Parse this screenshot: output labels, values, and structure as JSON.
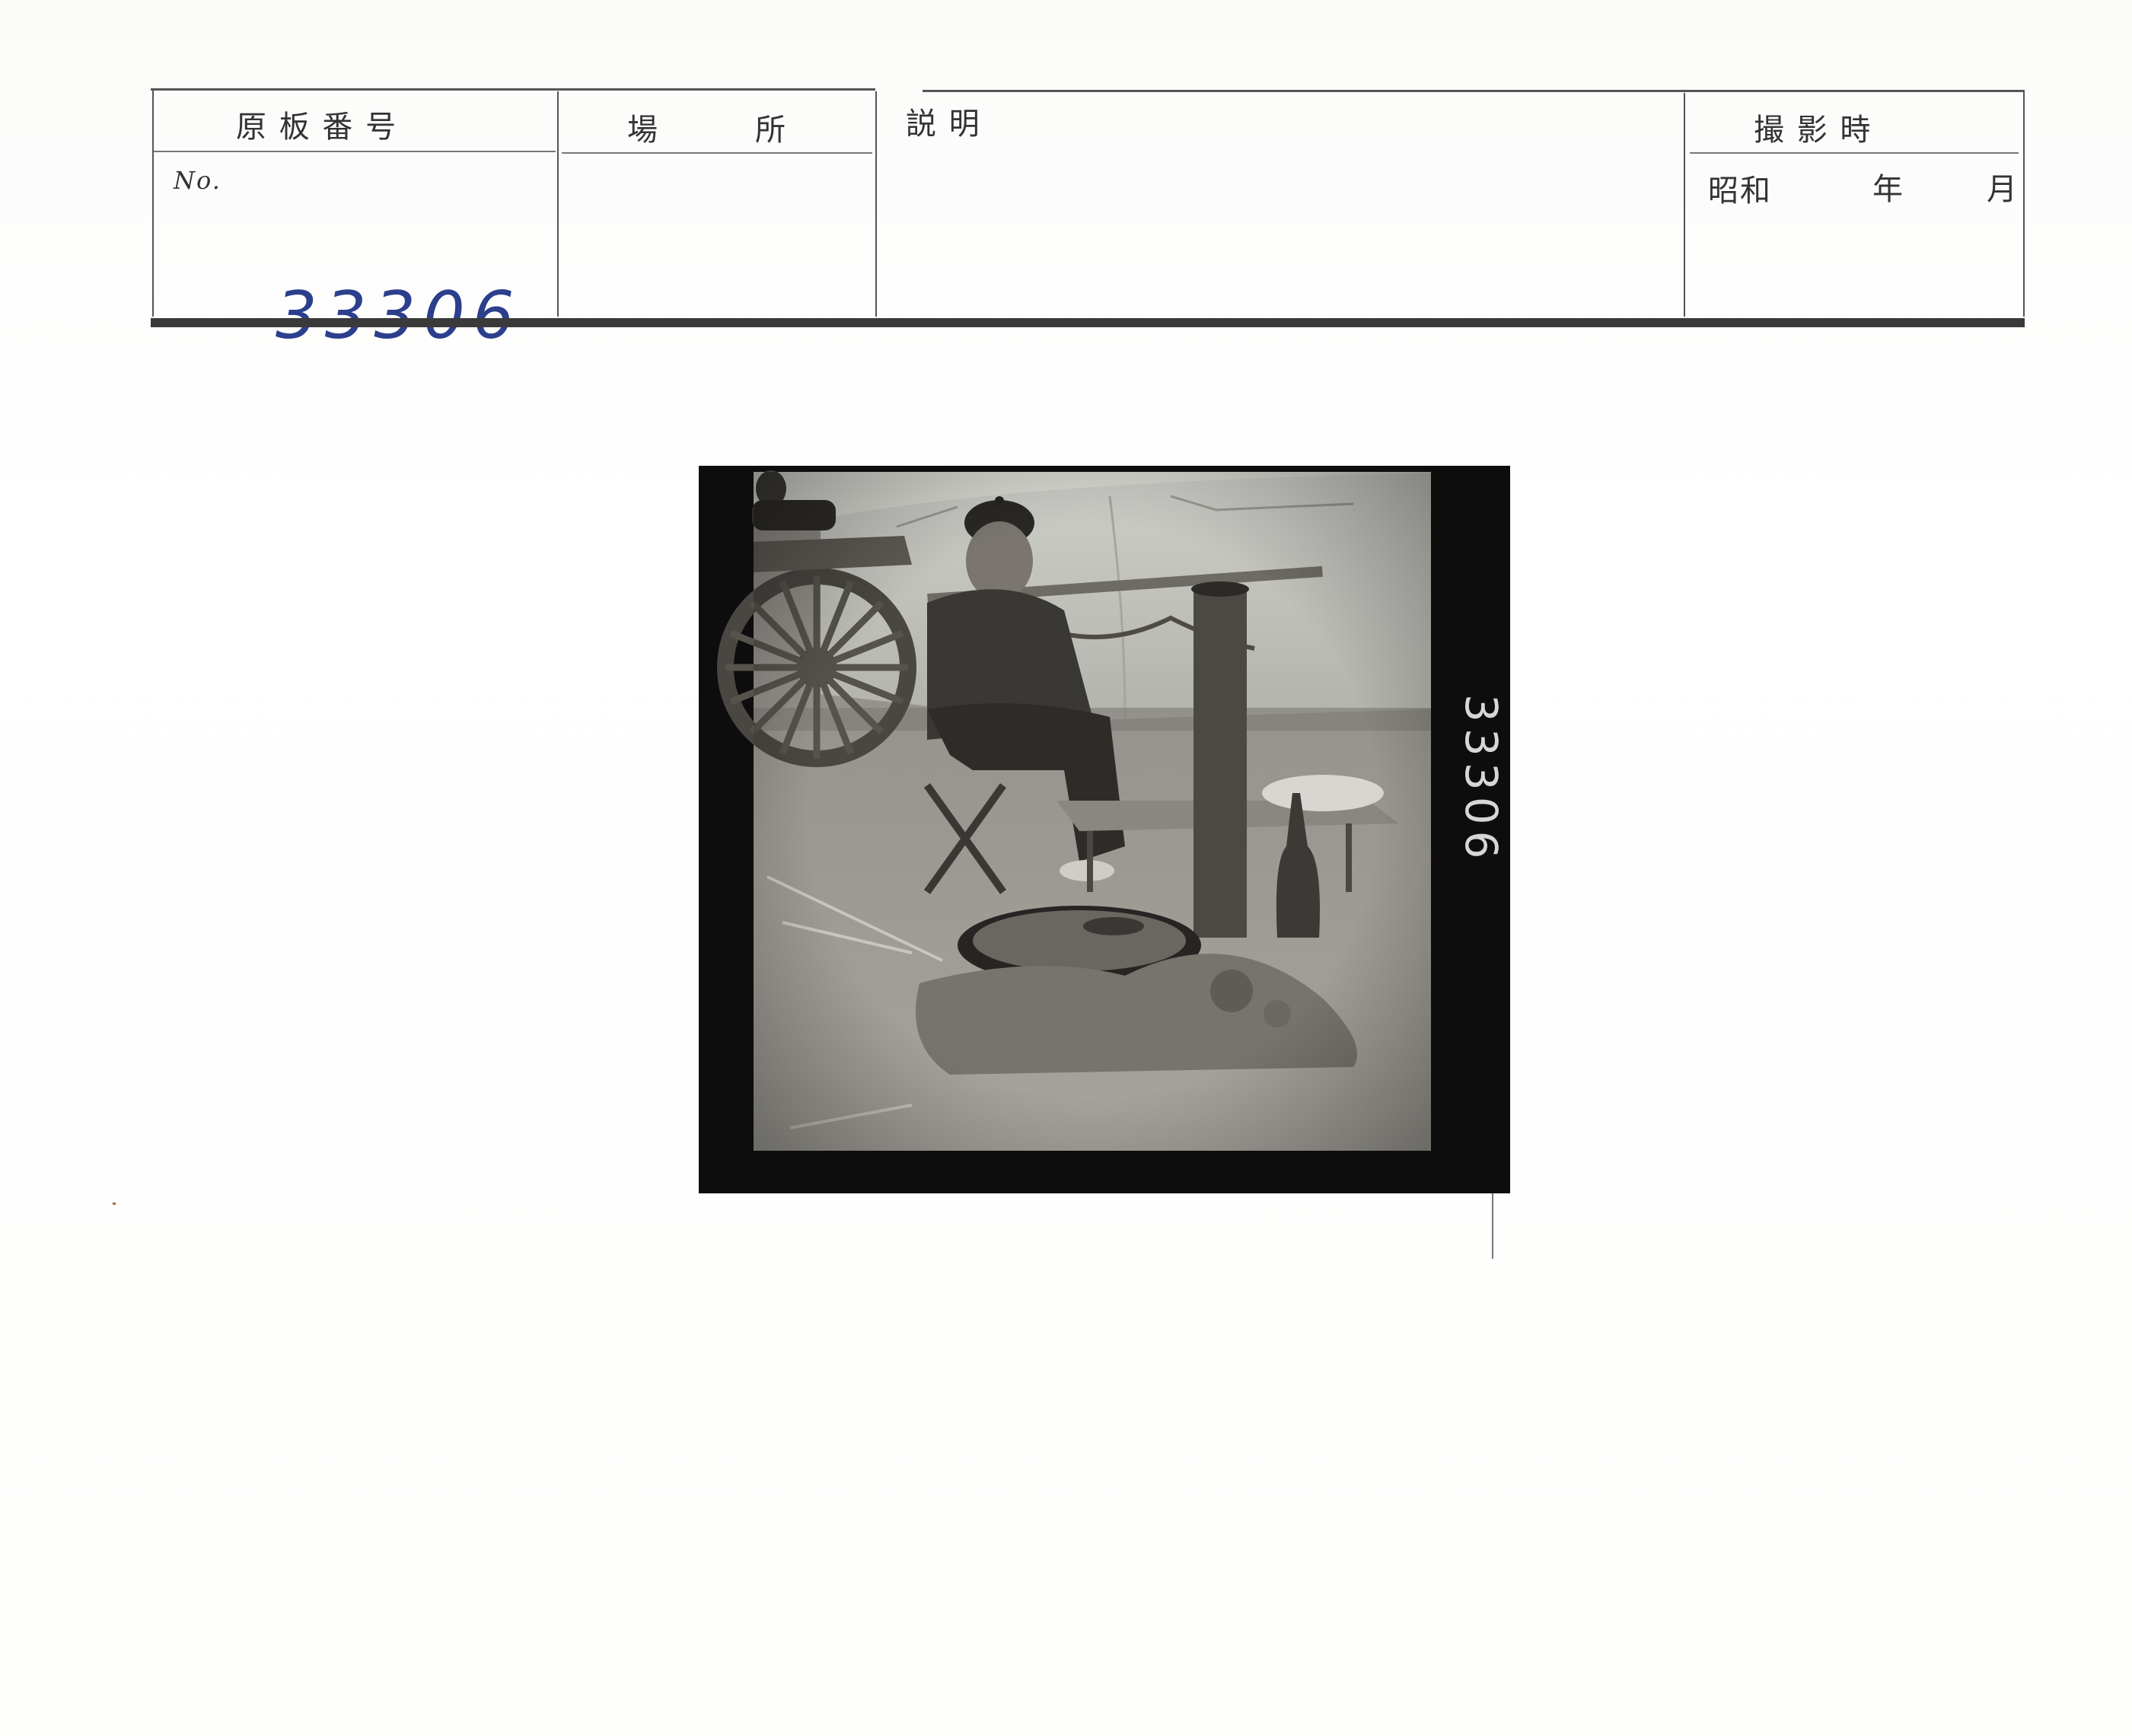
{
  "card": {
    "col_negative_number": "原 板 番 号",
    "col_location": "場　　　所",
    "col_description": "説 明",
    "col_date": "撮 影 時",
    "no_label": "No.",
    "era_label": "昭和",
    "year_label": "年",
    "month_label": "月",
    "handwritten_number": "33306"
  },
  "photo": {
    "edge_number": "33306"
  }
}
